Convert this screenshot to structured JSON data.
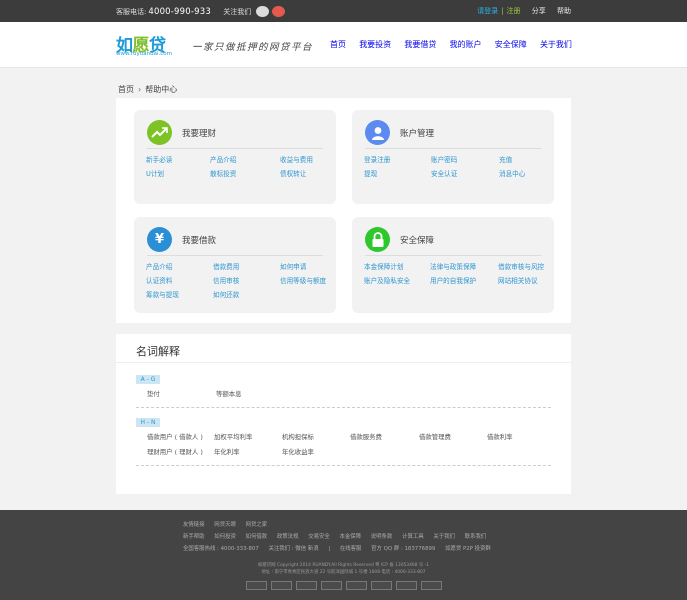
{
  "topbar": {
    "service_label": "客服电话:",
    "service_phone": "4000-990-933",
    "follow_label": "关注我们",
    "login": "请登录",
    "separator": "|",
    "register": "注册",
    "share": "分享",
    "help": "帮助"
  },
  "header": {
    "logo_text_a": "如",
    "logo_text_b": "愿",
    "logo_text_c": "贷",
    "logo_url": "www.ruyuandai.com",
    "slogan": "一家只做抵押的网贷平台",
    "nav": [
      "首页",
      "我要投资",
      "我要借贷",
      "我的账户",
      "安全保障",
      "关于我们"
    ]
  },
  "breadcrumb": {
    "home": "首页",
    "arrow": "›",
    "current": "帮助中心"
  },
  "help": {
    "cards": [
      {
        "title": "我要理财",
        "links": [
          "新手必读",
          "产品介绍",
          "收益与费用",
          "U计划",
          "散标投资",
          "债权转让"
        ]
      },
      {
        "title": "账户管理",
        "links": [
          "登录注册",
          "账户密码",
          "充值",
          "提现",
          "安全认证",
          "消息中心"
        ]
      },
      {
        "title": "我要借款",
        "links": [
          "产品介绍",
          "借款费用",
          "如何申请",
          "认证资料",
          "信用审核",
          "信用等级与额度",
          "筹款与提现",
          "如何还款"
        ]
      },
      {
        "title": "安全保障",
        "links": [
          "本金保障计划",
          "法律与政策保障",
          "借款审核与风控",
          "账户及隐私安全",
          "用户的自我保护",
          "网站相关协议"
        ]
      }
    ]
  },
  "glossary": {
    "title": "名词解释",
    "groups": [
      {
        "tag": "A - G",
        "terms": [
          "垫付",
          "等额本息"
        ]
      },
      {
        "tag": "H - N",
        "terms": [
          "借款用户 ( 借款人 )",
          "加权平均利率",
          "机构担保标",
          "借款服务费",
          "借款管理费",
          "借款利率",
          "理财用户 ( 理财人 )",
          "年化利率",
          "年化收益率"
        ]
      }
    ]
  },
  "footer": {
    "row1": [
      "友情链接",
      "网贷天眼",
      "网贷之家"
    ],
    "row2": [
      "新手帮助",
      "如何投资",
      "如何借款",
      "政策法规",
      "交易安全",
      "本金保障",
      "说明条款",
      "计算工具",
      "关于我们",
      "联系我们"
    ],
    "row3": [
      "全国客服热线 : 4000-333-807",
      "关注我们 : 微信  新浪",
      "|",
      "在线客服",
      "官方 QQ 群 : 183776899",
      "如愿贷 P2P 投资群"
    ],
    "copyright": "如愿贷网 Copyright 2014 RUANDY.All Rights Reserved 粤 ICP 备 13053468 号 -1",
    "address": "地址 : 南宁市青秀区民族大道 22 号航洋国际城 1 号楼 1608 电话 : 4000-333-807"
  },
  "colors": {
    "accent_blue": "#2f95d0",
    "accent_green": "#a0cf3a",
    "footer_bg": "#444444"
  }
}
